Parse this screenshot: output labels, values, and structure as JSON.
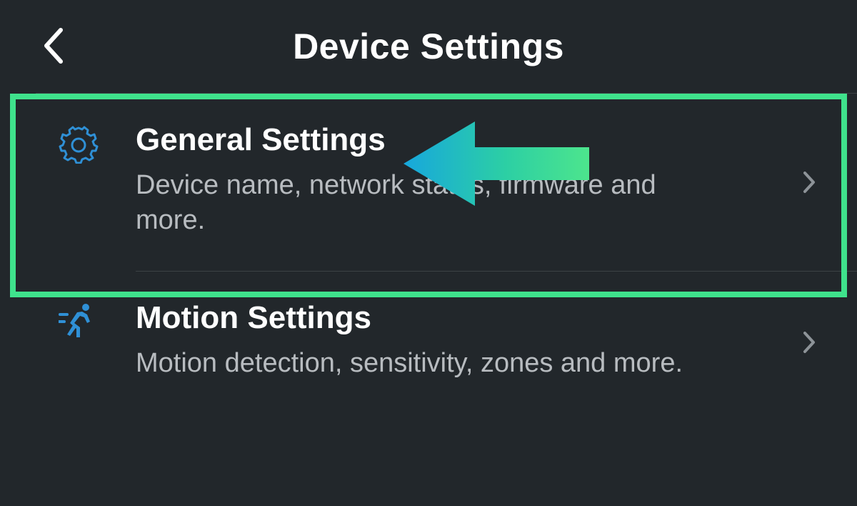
{
  "header": {
    "title": "Device Settings"
  },
  "items": [
    {
      "title": "General Settings",
      "subtitle": "Device name, network status, firmware and more."
    },
    {
      "title": "Motion Settings",
      "subtitle": "Motion detection, sensitivity, zones and more."
    }
  ]
}
